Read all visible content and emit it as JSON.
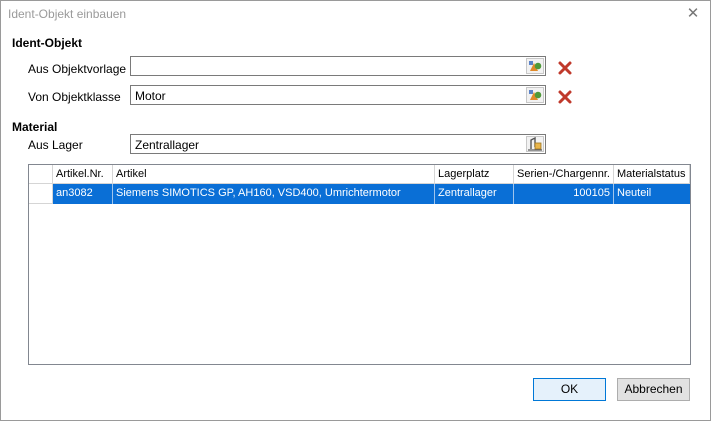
{
  "window": {
    "title": "Ident-Objekt einbauen"
  },
  "ident": {
    "heading": "Ident-Objekt",
    "template_label": "Aus Objektvorlage",
    "template_value": "",
    "class_label": "Von Objektklasse",
    "class_value": "Motor"
  },
  "material": {
    "heading": "Material",
    "stock_label": "Aus Lager",
    "stock_value": "Zentrallager"
  },
  "table": {
    "columns": [
      "Artikel.Nr.",
      "Artikel",
      "Lagerplatz",
      "Serien-/Chargennr.",
      "Materialstatus"
    ],
    "rows": [
      {
        "nr": "an3082",
        "article": "Siemens SIMOTICS GP, AH160, VSD400, Umrichtermotor",
        "location": "Zentrallager",
        "serial": "100105",
        "status": "Neuteil"
      }
    ]
  },
  "buttons": {
    "ok": "OK",
    "cancel": "Abbrechen"
  },
  "colors": {
    "selection": "#0a6fd6",
    "delete": "#c0392b",
    "default_button_border": "#0078d7"
  }
}
